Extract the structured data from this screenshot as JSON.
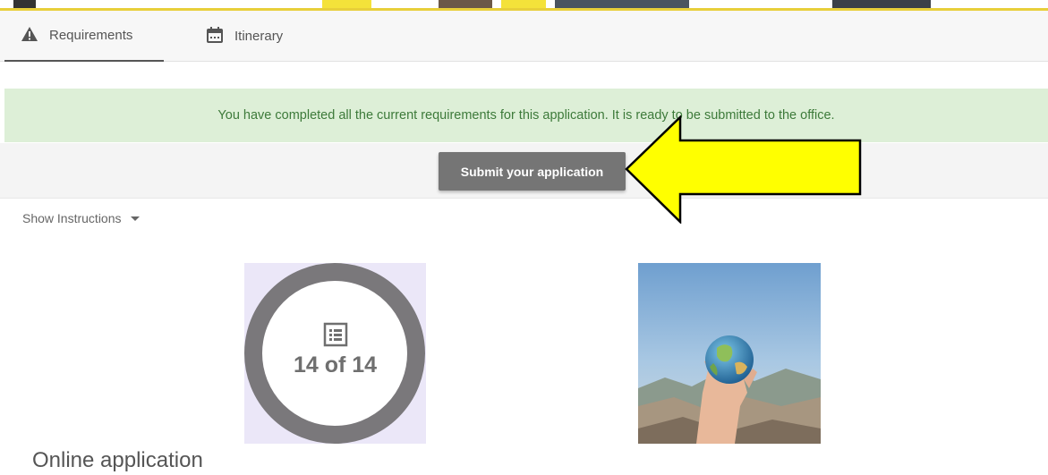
{
  "tabs": [
    {
      "label": "Requirements",
      "icon": "warning-icon",
      "active": true
    },
    {
      "label": "Itinerary",
      "icon": "calendar-icon",
      "active": false
    }
  ],
  "alert": {
    "message": "You have completed all the current requirements for this application. It is ready to be submitted to the office."
  },
  "actions": {
    "submit_label": "Submit your application"
  },
  "instructions": {
    "toggle_label": "Show Instructions"
  },
  "progress_card": {
    "label": "14 of 14",
    "completed": 14,
    "total": 14,
    "icon": "list-icon"
  },
  "image_card": {
    "icon": "globe-in-hand-photo"
  },
  "section": {
    "title": "Online application"
  },
  "colors": {
    "accent_yellow": "#ffff00",
    "alert_bg": "#ddefd7",
    "alert_text": "#3d7a3a",
    "button_bg": "#757575",
    "ring": "#7a787b"
  }
}
